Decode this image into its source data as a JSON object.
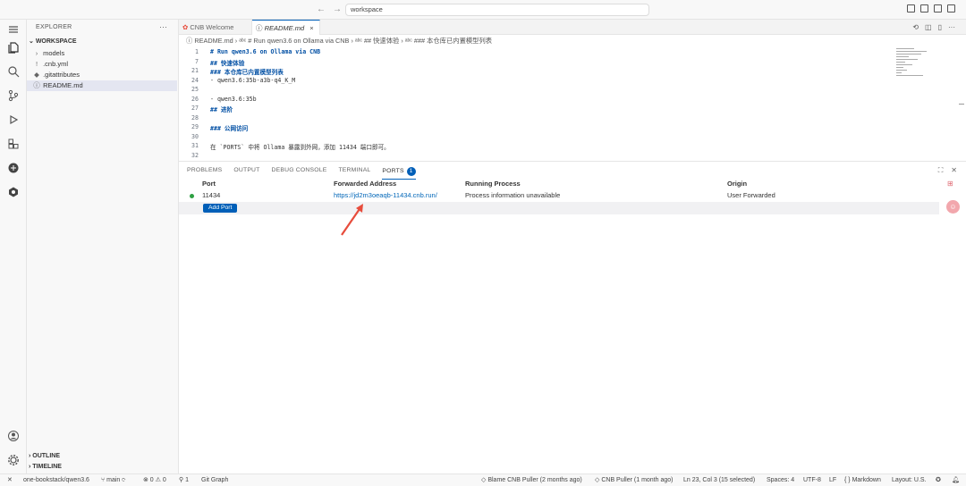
{
  "titlebar": {
    "search": "workspace",
    "back": "←",
    "forward": "→"
  },
  "activity": {
    "icons": [
      "menu-icon",
      "files-icon",
      "search-icon",
      "source-control-icon",
      "run-debug-icon",
      "extensions-icon",
      "cnb-icon",
      "remote-icon",
      "account-icon",
      "settings-icon"
    ]
  },
  "sidebar": {
    "title": "EXPLORER",
    "more": "···",
    "workspace": "WORKSPACE",
    "items": [
      {
        "label": "models",
        "icon": "›"
      },
      {
        "label": ".cnb.yml",
        "icon": "!"
      },
      {
        "label": ".gitattributes",
        "icon": "◆"
      },
      {
        "label": "README.md",
        "icon": "ⓘ"
      }
    ],
    "outline": "OUTLINE",
    "timeline": "TIMELINE"
  },
  "tabs": [
    {
      "label": "CNB Welcome",
      "active": false
    },
    {
      "label": "README.md",
      "active": true,
      "close": "×"
    }
  ],
  "breadcrumb": "ⓘ README.md  ›  ᵃᵇᶜ # Run qwen3.6 on Ollama via CNB  ›  ᵃᵇᶜ ## 快速体验  ›  ᵃᵇᶜ ### 本仓库已内置模型列表",
  "editor": {
    "lines": [
      {
        "n": "1",
        "text": "# Run qwen3.6 on Ollama via CNB",
        "h": true
      },
      {
        "n": "7",
        "text": "## 快速体验",
        "h": true
      },
      {
        "n": "21",
        "text": "### 本仓库已内置模型列表",
        "h": true
      },
      {
        "n": "24",
        "text": "- qwen3.6:35b-a3b-q4_K_M",
        "h": false
      },
      {
        "n": "25",
        "text": "",
        "h": false
      },
      {
        "n": "26",
        "text": "- qwen3.6:35b",
        "h": false
      },
      {
        "n": "27",
        "text": "## 进阶",
        "h": true
      },
      {
        "n": "28",
        "text": "",
        "h": false
      },
      {
        "n": "29",
        "text": "### 公网访问",
        "h": true
      },
      {
        "n": "30",
        "text": "",
        "h": false
      },
      {
        "n": "31",
        "text": "在 `PORTS` 中将 Ollama 暴露到外网，添加 11434 端口即可。",
        "h": false
      },
      {
        "n": "32",
        "text": "",
        "h": false
      }
    ]
  },
  "panel": {
    "tabs": [
      "PROBLEMS",
      "OUTPUT",
      "DEBUG CONSOLE",
      "TERMINAL",
      "PORTS"
    ],
    "ports_badge": "1",
    "columns": [
      "Port",
      "Forwarded Address",
      "Running Process",
      "Origin"
    ],
    "row": {
      "port": "11434",
      "address": "https://jd2m3oeaqb-11434.cnb.run/",
      "process": "Process information unavailable",
      "origin": "User Forwarded"
    },
    "add_port": "Add Port"
  },
  "status": {
    "repo": "one-bookstack/qwen3.6",
    "branch": "main",
    "problems": "⊗ 0 ⚠ 0",
    "ports": "1",
    "git_graph": "Git Graph",
    "blame": "Blame CNB Puller (2 months ago)",
    "puller": "CNB Puller (1 month ago)",
    "cursor": "Ln 23, Col 3 (15 selected)",
    "spaces": "Spaces: 4",
    "encoding": "UTF-8",
    "eol": "LF",
    "lang": "{ } Markdown",
    "layout": "Layout: U.S."
  },
  "colors": {
    "accent": "#005fb8",
    "annotation_arrow": "#e74c3c",
    "link": "#0066b8"
  }
}
